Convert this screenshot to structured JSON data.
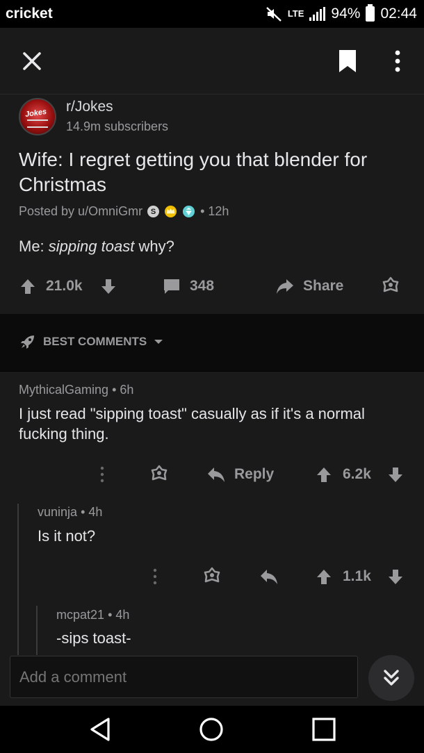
{
  "status_bar": {
    "carrier": "cricket",
    "network": "LTE",
    "battery": "94%",
    "time": "02:44"
  },
  "post": {
    "subreddit": "r/Jokes",
    "avatar_text": "Jokes",
    "subscribers": "14.9m subscribers",
    "title": "Wife: I regret getting you that blender for Christmas",
    "posted_by": "Posted by u/OmniGmr",
    "flair_1": "S",
    "age": "• 12h",
    "body_prefix": "Me: ",
    "body_italic": "sipping toast",
    "body_suffix": " why?",
    "upvotes": "21.0k",
    "comments": "348",
    "share": "Share"
  },
  "sort": {
    "label": "BEST COMMENTS"
  },
  "comments": [
    {
      "author": "MythicalGaming",
      "age": "• 6h",
      "text": "I just read \"sipping toast\" casually as if it's a normal fucking thing.",
      "reply": "Reply",
      "score": "6.2k"
    },
    {
      "author": "vuninja",
      "age": "• 4h",
      "text": "Is it not?",
      "score": "1.1k"
    },
    {
      "author": "mcpat21",
      "age": "• 4h",
      "text": "-sips toast-"
    }
  ],
  "composer": {
    "placeholder": "Add a comment"
  },
  "colors": {
    "background": "#1a1a1b",
    "divider": "#0b0b0b",
    "text": "#d7dadc",
    "muted": "#9a9a9c"
  }
}
